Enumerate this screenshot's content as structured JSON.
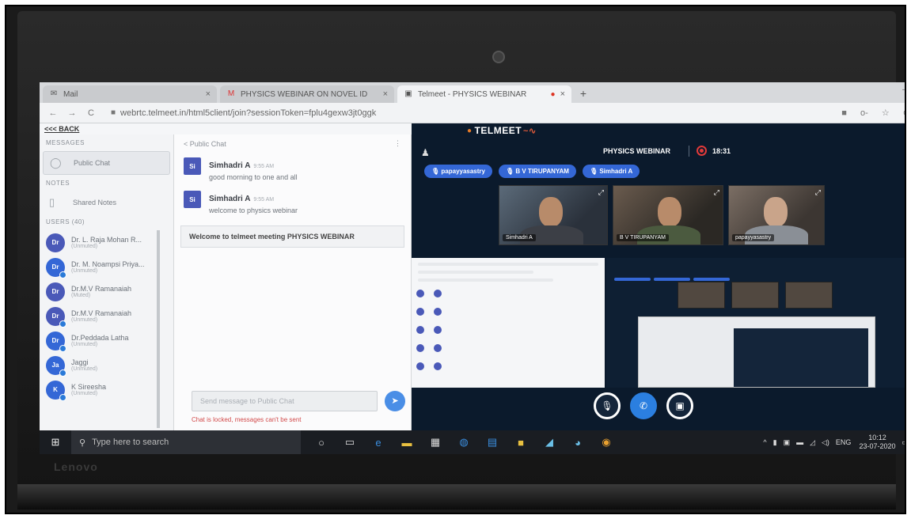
{
  "browser": {
    "tabs": [
      {
        "icon": "mail-icon",
        "label": "Mail",
        "active": false
      },
      {
        "icon": "gmail-icon",
        "label": "PHYSICS WEBINAR ON NOVEL ID",
        "active": false
      },
      {
        "icon": "telmeet-icon",
        "label": "Telmeet - PHYSICS WEBINAR",
        "active": true
      }
    ],
    "url": "webrtc.telmeet.in/html5client/join?sessionToken=fplu4gexw3jt0ggk"
  },
  "app": {
    "back_label": "<<< BACK",
    "sidebar": {
      "messages_header": "MESSAGES",
      "public_chat": "Public Chat",
      "notes_header": "NOTES",
      "shared_notes": "Shared Notes",
      "users_header": "USERS (40)",
      "users": [
        {
          "initials": "Dr",
          "name": "Dr. L. Raja Mohan R...",
          "status": "(Unmuted)",
          "color": "#4a59b8"
        },
        {
          "initials": "Dr",
          "name": "Dr. M. Noampsi Priya...",
          "status": "(Unmuted)",
          "color": "#3467d6"
        },
        {
          "initials": "Dr",
          "name": "Dr.M.V Ramanaiah",
          "status": "(Muted)",
          "color": "#4a59b8"
        },
        {
          "initials": "Dr",
          "name": "Dr.M.V Ramanaiah",
          "status": "(Unmuted)",
          "color": "#4a59b8"
        },
        {
          "initials": "Dr",
          "name": "Dr.Peddada Latha",
          "status": "(Unmuted)",
          "color": "#3467d6"
        },
        {
          "initials": "Ja",
          "name": "Jaggi",
          "status": "(Unmuted)",
          "color": "#3467d6"
        },
        {
          "initials": "K",
          "name": "K Sireesha",
          "status": "(Unmuted)",
          "color": "#3467d6"
        }
      ]
    },
    "chat": {
      "header": "< Public Chat",
      "messages": [
        {
          "initials": "Si",
          "sender": "Simhadri A",
          "time": "9:55 AM",
          "text": "good morning to one and all"
        },
        {
          "initials": "Si",
          "sender": "Simhadri A",
          "time": "9:55 AM",
          "text": "welcome to physics webinar"
        }
      ],
      "welcome": "Welcome to telmeet meeting PHYSICS WEBINAR",
      "input_placeholder": "Send message to Public Chat",
      "locked_notice": "Chat is locked, messages can't be sent"
    },
    "video": {
      "logo": "TELMEET",
      "meeting_title": "PHYSICS WEBINAR",
      "timer": "18:31",
      "presenters": [
        "papayyasastry",
        "B V TIRUPANYAM",
        "Simhadri A"
      ],
      "tiles": [
        {
          "name": "Simhadri A"
        },
        {
          "name": "B V TIRUPANYAM"
        },
        {
          "name": "papayyasastry"
        }
      ]
    }
  },
  "taskbar": {
    "search_placeholder": "Type here to search",
    "lang": "ENG",
    "time": "10:12",
    "date": "23-07-2020"
  },
  "laptop": {
    "brand": "Lenovo"
  }
}
